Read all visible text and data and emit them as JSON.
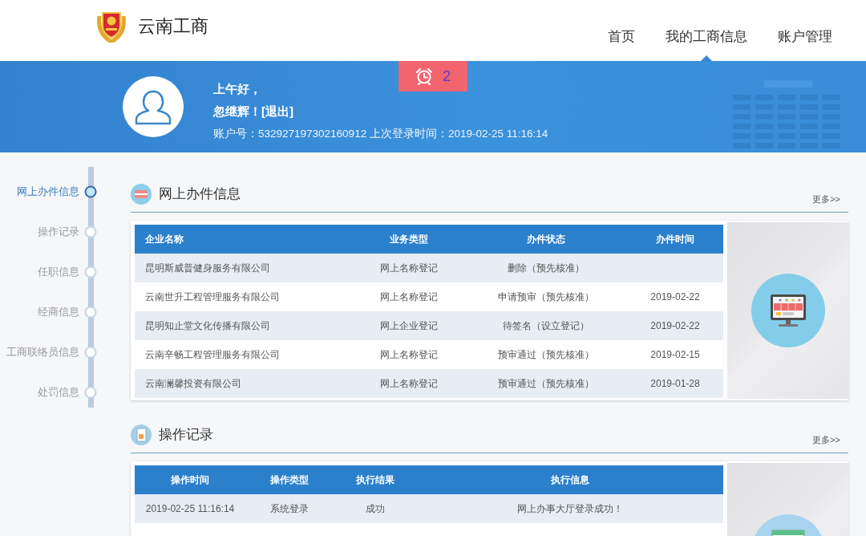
{
  "header": {
    "site_title": "云南工商",
    "nav": [
      {
        "label": "首页",
        "selected": false
      },
      {
        "label": "我的工商信息",
        "selected": true
      },
      {
        "label": "账户管理",
        "selected": false
      }
    ]
  },
  "banner": {
    "reminder_count": "2",
    "greeting": "上午好，",
    "user_name": "忽继辉！",
    "logout_link": "[退出]",
    "account_number": "账户号：532927197302160912",
    "last_login": "上次登录时间：2019-02-25 11:16:14"
  },
  "sidebar": {
    "items": [
      {
        "label": "网上办件信息",
        "selected": true
      },
      {
        "label": "操作记录",
        "selected": false
      },
      {
        "label": "任职信息",
        "selected": false
      },
      {
        "label": "经商信息",
        "selected": false
      },
      {
        "label": "工商联络员信息",
        "selected": false
      },
      {
        "label": "处罚信息",
        "selected": false
      }
    ]
  },
  "sections": [
    {
      "kind": "cases",
      "title": "网上办件信息",
      "more_link": "更多>>",
      "table": {
        "columns": [
          "企业名称",
          "业务类型",
          "办件状态",
          "办件时间"
        ],
        "rows": [
          [
            "昆明斯威普健身服务有限公司",
            "网上名称登记",
            "删除（预先核准）"
          ],
          [
            "云南世升工程管理服务有限公司",
            "网上名称登记",
            "申请预审（预先核准）",
            "2019-02-22"
          ],
          [
            "昆明知止堂文化传播有限公司",
            "网上企业登记",
            "待签名（设立登记）",
            "2019-02-22"
          ],
          [
            "云南辛畅工程管理服务有限公司",
            "网上名称登记",
            "预审通过（预先核准）",
            "2019-02-15"
          ],
          [
            "云南澜馨投资有限公司",
            "网上名称登记",
            "预审通过（预先核准）",
            "2019-01-28"
          ]
        ]
      }
    },
    {
      "kind": "operations",
      "title": "操作记录",
      "more_link": "更多>>",
      "table": {
        "columns": [
          "操作时间",
          "操作类型",
          "执行结果",
          "执行信息"
        ],
        "rows": [
          [
            "2019-02-25 11:16:14",
            "系统登录",
            "成功",
            "网上办事大厅登录成功！"
          ]
        ]
      }
    }
  ]
}
